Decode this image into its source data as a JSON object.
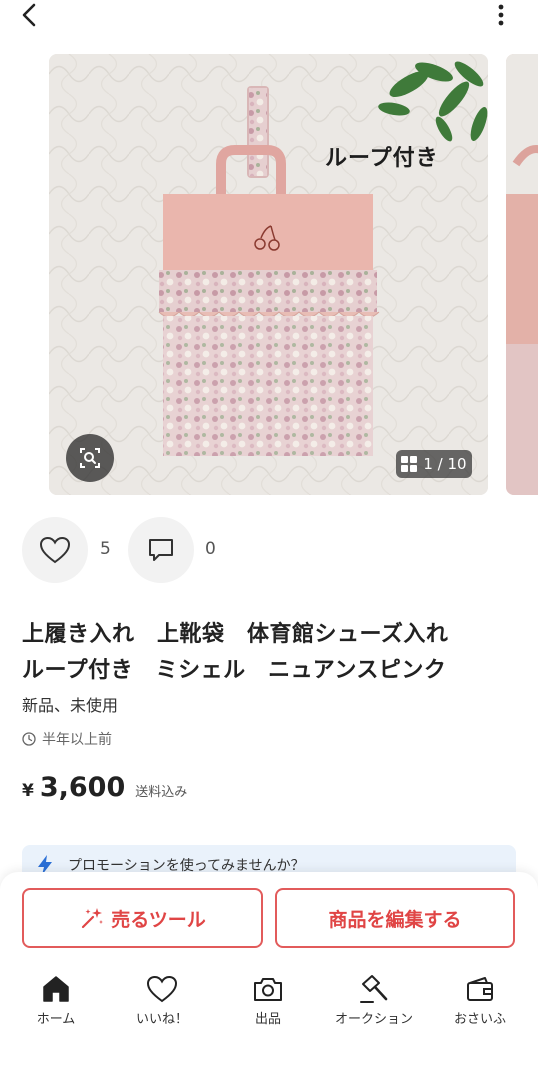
{
  "header": {
    "back_icon": "chevron-left-icon",
    "more_icon": "more-vertical-icon"
  },
  "gallery": {
    "caption": "ループ付き",
    "counter": "1 / 10",
    "lens_icon": "image-search-icon",
    "grid_icon": "grid-icon"
  },
  "engagement": {
    "likes": "5",
    "comments": "0"
  },
  "item": {
    "title_line1": "上履き入れ　上靴袋　体育館シューズ入れ",
    "title_line2": "ループ付き　ミシェル　ニュアンスピンク",
    "condition": "新品、未使用",
    "listed": "半年以上前",
    "currency": "¥",
    "price": "3,600",
    "shipping": "送料込み"
  },
  "promo": {
    "text": "プロモーションを使ってみませんか？"
  },
  "actions": {
    "sell_tool": "売るツール",
    "edit_item": "商品を編集する"
  },
  "tabs": [
    {
      "label": "ホーム",
      "icon": "home-icon"
    },
    {
      "label": "いいね！",
      "icon": "heart-icon"
    },
    {
      "label": "出品",
      "icon": "camera-icon"
    },
    {
      "label": "オークション",
      "icon": "gavel-icon"
    },
    {
      "label": "おさいふ",
      "icon": "wallet-icon"
    }
  ],
  "colors": {
    "accent": "#e04545",
    "promo_bg": "#eaf2fb"
  }
}
